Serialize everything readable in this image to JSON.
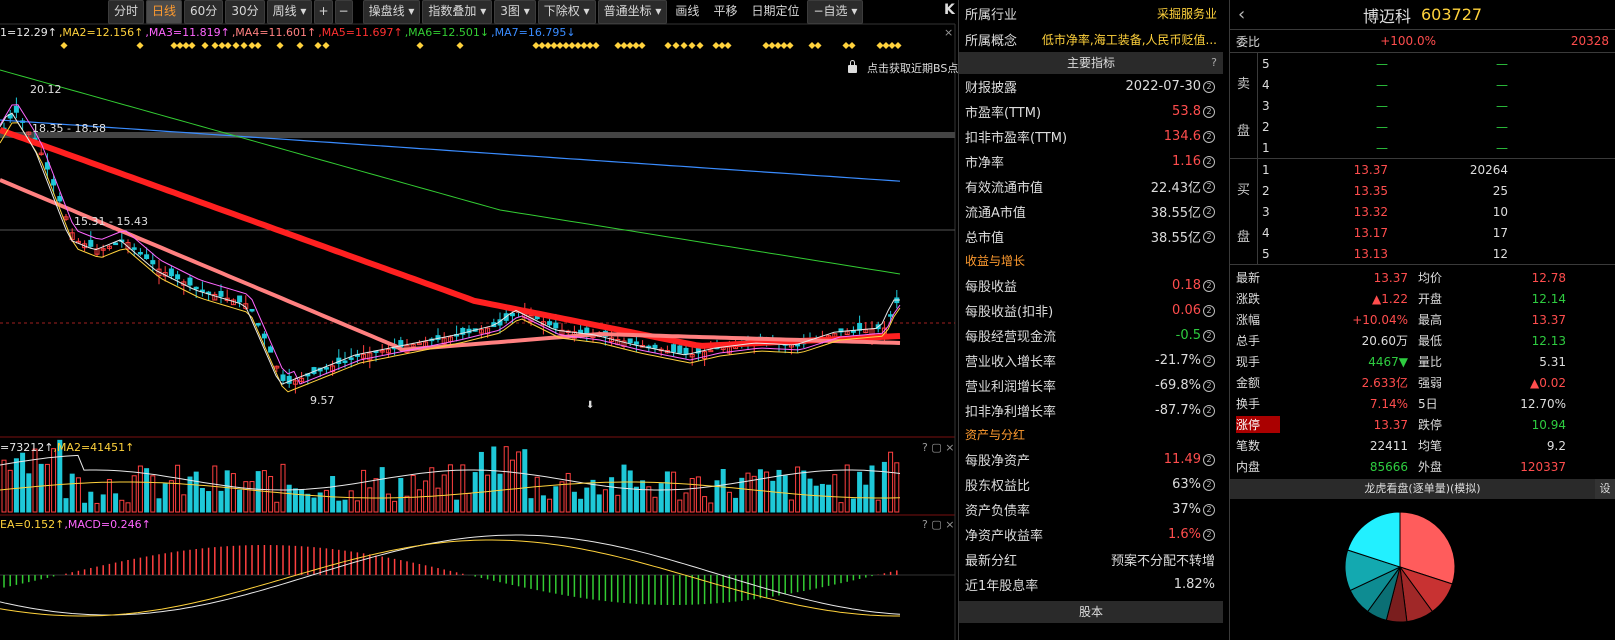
{
  "toolbar": {
    "buttons": [
      "分时",
      "日线",
      "60分",
      "30分",
      "周线 ▾",
      "+",
      "−",
      "操盘线 ▾",
      "指数叠加 ▾",
      "3图 ▾",
      "下除权 ▾",
      "普通坐标 ▾",
      "画线",
      "平移",
      "日期定位",
      "−自选 ▾"
    ],
    "active": "日线"
  },
  "ma_line": [
    {
      "text": "1=12.29↑",
      "color": "#e8e8e8"
    },
    {
      "text": ",MA2=12.156↑",
      "color": "#ffd23c"
    },
    {
      "text": ",MA3=11.819↑",
      "color": "#ff66ff"
    },
    {
      "text": ",MA4=11.601↑",
      "color": "#ff8080"
    },
    {
      "text": ",MA5=11.697↑",
      "color": "#ff3030"
    },
    {
      "text": ",MA6=12.501↓",
      "color": "#33cc33"
    },
    {
      "text": ",MA7=16.795↓",
      "color": "#3a8cff"
    }
  ],
  "price_labels": {
    "high": "20.12",
    "range1": "18.35 - 18.58",
    "range2": "15.31 - 15.43",
    "low": "9.57"
  },
  "bs_hint": "点击获取近期BS点",
  "vol_label": [
    {
      "text": "=73212↑",
      "color": "#e8e8e8"
    },
    {
      "text": ",MA2=41451↑",
      "color": "#ffd23c"
    }
  ],
  "macd_label": [
    {
      "text": "EA=0.152↑",
      "color": "#ffd23c"
    },
    {
      "text": ",MACD=0.246↑",
      "color": "#ff66ff"
    }
  ],
  "icons": {
    "close": "×",
    "question": "?",
    "expand": "▢",
    "collapse": "K"
  },
  "finance": {
    "industry_label": "所属行业",
    "industry_value": "采掘服务业",
    "concept_label": "所属概念",
    "concept_value": "低市净率,海工装备,人民币贬值...",
    "main_header": "主要指标",
    "rows1": [
      {
        "label": "财报披露",
        "value": "2022-07-30",
        "cls": ""
      },
      {
        "label": "市盈率(TTM)",
        "value": "53.8",
        "cls": "red"
      },
      {
        "label": "扣非市盈率(TTM)",
        "value": "134.6",
        "cls": "red"
      },
      {
        "label": "市净率",
        "value": "1.16",
        "cls": "red"
      },
      {
        "label": "有效流通市值",
        "value": "22.43亿",
        "cls": ""
      },
      {
        "label": "流通A市值",
        "value": "38.55亿",
        "cls": ""
      },
      {
        "label": "总市值",
        "value": "38.55亿",
        "cls": ""
      }
    ],
    "section2": "收益与增长",
    "rows2": [
      {
        "label": "每股收益",
        "value": "0.18",
        "cls": "red"
      },
      {
        "label": "每股收益(扣非)",
        "value": "0.06",
        "cls": "red"
      },
      {
        "label": "每股经营现金流",
        "value": "-0.5",
        "cls": "green"
      },
      {
        "label": "营业收入增长率",
        "value": "-21.7%",
        "cls": ""
      },
      {
        "label": "营业利润增长率",
        "value": "-69.8%",
        "cls": ""
      },
      {
        "label": "扣非净利增长率",
        "value": "-87.7%",
        "cls": ""
      }
    ],
    "section3": "资产与分红",
    "rows3": [
      {
        "label": "每股净资产",
        "value": "11.49",
        "cls": "red"
      },
      {
        "label": "股东权益比",
        "value": "63%",
        "cls": ""
      },
      {
        "label": "资产负债率",
        "value": "37%",
        "cls": ""
      },
      {
        "label": "净资产收益率",
        "value": "1.6%",
        "cls": "red"
      },
      {
        "label": "最新分红",
        "value": "预案不分配不转增",
        "cls": "",
        "noq": true
      },
      {
        "label": "近1年股息率",
        "value": "1.82%",
        "cls": "",
        "noq": true
      }
    ],
    "footer": "股本"
  },
  "quote": {
    "name": "博迈科",
    "code": "603727",
    "webi_label": "委比",
    "webi_pct": "+100.0%",
    "webi_val": "20328",
    "sell_label": "卖盘",
    "buy_label": "买盘",
    "sells": [
      {
        "lv": "5",
        "p": "—",
        "v": "—"
      },
      {
        "lv": "4",
        "p": "—",
        "v": "—"
      },
      {
        "lv": "3",
        "p": "—",
        "v": "—"
      },
      {
        "lv": "2",
        "p": "—",
        "v": "—"
      },
      {
        "lv": "1",
        "p": "—",
        "v": "—"
      }
    ],
    "buys": [
      {
        "lv": "1",
        "p": "13.37",
        "v": "20264"
      },
      {
        "lv": "2",
        "p": "13.35",
        "v": "25"
      },
      {
        "lv": "3",
        "p": "13.32",
        "v": "10"
      },
      {
        "lv": "4",
        "p": "13.17",
        "v": "17"
      },
      {
        "lv": "5",
        "p": "13.13",
        "v": "12"
      }
    ],
    "stats": [
      {
        "k": "最新",
        "v": "13.37",
        "k2": "均价",
        "v2": "12.78"
      },
      {
        "k": "涨跌",
        "v": "▲1.22",
        "k2": "开盘",
        "v2": "12.14"
      },
      {
        "k": "涨幅",
        "v": "+10.04%",
        "k2": "最高",
        "v2": "13.37"
      },
      {
        "k": "总手",
        "v": "20.60万",
        "k2": "最低",
        "v2": "12.13"
      },
      {
        "k": "现手",
        "v": "4467▼",
        "k2": "量比",
        "v2": "5.31"
      },
      {
        "k": "金额",
        "v": "2.633亿",
        "k2": "强弱",
        "v2": "▲0.02"
      },
      {
        "k": "换手",
        "v": "7.14%",
        "k2": "5日",
        "v2": "12.70%"
      },
      {
        "k": "涨停",
        "v": "13.37",
        "k2": "跌停",
        "v2": "10.94"
      },
      {
        "k": "笔数",
        "v": "22411",
        "k2": "均笔",
        "v2": "9.2"
      },
      {
        "k": "内盘",
        "v": "85666",
        "k2": "外盘",
        "v2": "120337"
      }
    ],
    "lh_title": "龙虎看盘(逐单量)(模拟)",
    "lh_set": "设",
    "pie": [
      {
        "pct": 0.3,
        "color": "#ff5c5c"
      },
      {
        "pct": 0.1,
        "color": "#c83232"
      },
      {
        "pct": 0.08,
        "color": "#a02828"
      },
      {
        "pct": 0.06,
        "color": "#7a1e1e"
      },
      {
        "pct": 0.06,
        "color": "#0b6f74"
      },
      {
        "pct": 0.08,
        "color": "#0e8c92"
      },
      {
        "pct": 0.12,
        "color": "#13a9b0"
      },
      {
        "pct": 0.2,
        "color": "#22f0ff"
      }
    ]
  }
}
